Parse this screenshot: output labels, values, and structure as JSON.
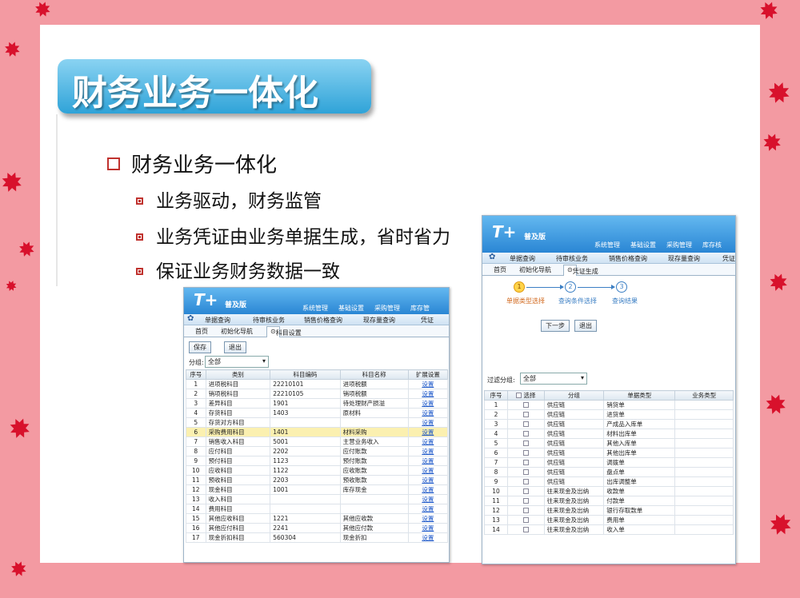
{
  "title": "财务业务一体化",
  "heading": "财务业务一体化",
  "bullets": [
    "业务驱动，财务监管",
    "业务凭证由业务单据生成，省时省力",
    "保证业务财务数据一致"
  ],
  "win1": {
    "logo": "T+",
    "edition": "普及版",
    "menu": [
      "系统管理",
      "基础设置",
      "采购管理",
      "库存管"
    ],
    "toolbar": [
      "单据查询",
      "待审核业务",
      "销售价格查询",
      "现存量查询",
      "凭证"
    ],
    "tabs": [
      "首页",
      "初始化导航",
      "科目设置"
    ],
    "buttons": [
      "保存",
      "退出"
    ],
    "group_label": "分组:",
    "group_value": "全部",
    "headers": [
      "序号",
      "类别",
      "科目编码",
      "科目名称",
      "扩展设置"
    ],
    "rows": [
      [
        "1",
        "进项税科目",
        "22210101",
        "进项税额",
        "设置"
      ],
      [
        "2",
        "销项税科目",
        "22210105",
        "销项税额",
        "设置"
      ],
      [
        "3",
        "差异科目",
        "1901",
        "待处理财产损溢",
        "设置"
      ],
      [
        "4",
        "存货科目",
        "1403",
        "原材料",
        "设置"
      ],
      [
        "5",
        "存货对方科目",
        "",
        "",
        "设置"
      ],
      [
        "6",
        "采购费用科目",
        "1401",
        "材料采购",
        "设置"
      ],
      [
        "7",
        "销售收入科目",
        "5001",
        "主营业务收入",
        "设置"
      ],
      [
        "8",
        "应付科目",
        "2202",
        "应付账款",
        "设置"
      ],
      [
        "9",
        "预付科目",
        "1123",
        "预付账款",
        "设置"
      ],
      [
        "10",
        "应收科目",
        "1122",
        "应收账款",
        "设置"
      ],
      [
        "11",
        "预收科目",
        "2203",
        "预收账款",
        "设置"
      ],
      [
        "12",
        "现金科目",
        "1001",
        "库存现金",
        "设置"
      ],
      [
        "13",
        "收入科目",
        "",
        "",
        "设置"
      ],
      [
        "14",
        "费用科目",
        "",
        "",
        "设置"
      ],
      [
        "15",
        "其他应收科目",
        "1221",
        "其他应收款",
        "设置"
      ],
      [
        "16",
        "其他应付科目",
        "2241",
        "其他应付款",
        "设置"
      ],
      [
        "17",
        "现金折扣科目",
        "560304",
        "现金折扣",
        "设置"
      ]
    ]
  },
  "win2": {
    "logo": "T+",
    "edition": "普及版",
    "menu": [
      "系统管理",
      "基础设置",
      "采购管理",
      "库存核"
    ],
    "toolbar": [
      "单据查询",
      "待审核业务",
      "销售价格查询",
      "现存量查询",
      "凭证"
    ],
    "tabs": [
      "首页",
      "初始化导航",
      "凭证生成"
    ],
    "steps": [
      "单据类型选择",
      "查询条件选择",
      "查询结果"
    ],
    "buttons": [
      "下一步",
      "退出"
    ],
    "filter_label": "过滤分组:",
    "filter_value": "全部",
    "headers": [
      "序号",
      "选择",
      "分组",
      "单据类型",
      "业务类型"
    ],
    "rows": [
      [
        "1",
        "供应链",
        "销货单"
      ],
      [
        "2",
        "供应链",
        "进货单"
      ],
      [
        "3",
        "供应链",
        "产成品入库单"
      ],
      [
        "4",
        "供应链",
        "材料出库单"
      ],
      [
        "5",
        "供应链",
        "其他入库单"
      ],
      [
        "6",
        "供应链",
        "其他出库单"
      ],
      [
        "7",
        "供应链",
        "调拨单"
      ],
      [
        "8",
        "供应链",
        "盘点单"
      ],
      [
        "9",
        "供应链",
        "出库调整单"
      ],
      [
        "10",
        "往来现金及出纳",
        "收款单"
      ],
      [
        "11",
        "往来现金及出纳",
        "付款单"
      ],
      [
        "12",
        "往来现金及出纳",
        "银行存取款单"
      ],
      [
        "13",
        "往来现金及出纳",
        "费用单"
      ],
      [
        "14",
        "往来现金及出纳",
        "收入单"
      ]
    ]
  }
}
